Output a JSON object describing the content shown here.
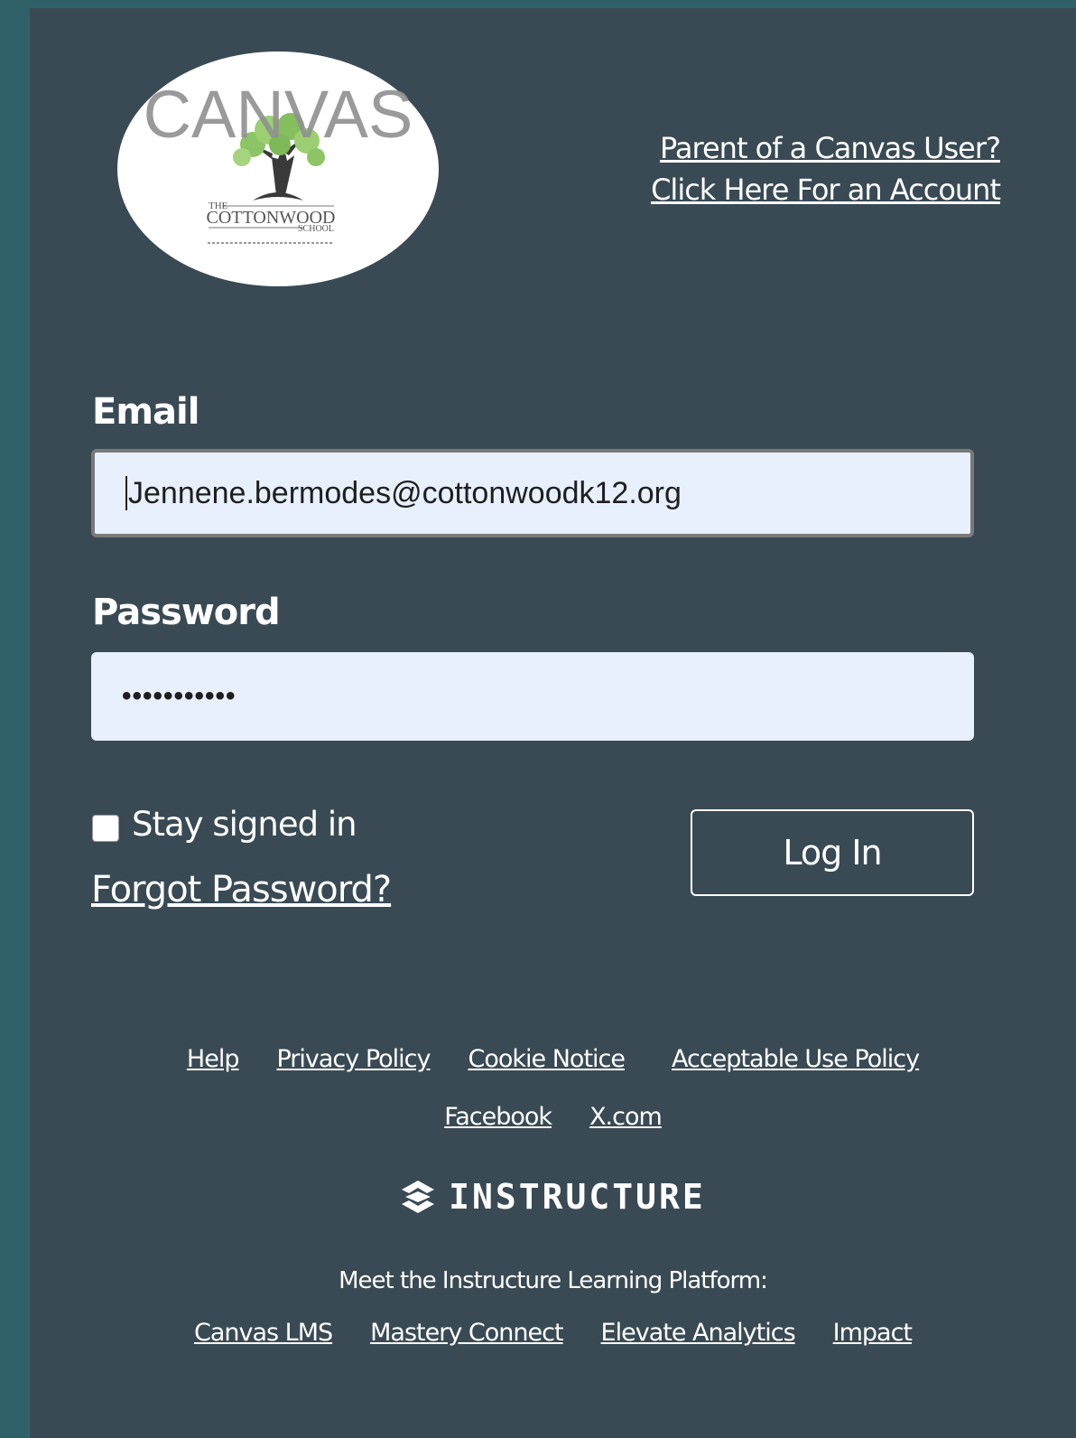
{
  "logo": {
    "title": "CANVAS",
    "school_line1": "THE",
    "school_line2": "COTTONWOOD",
    "school_line3": "SCHOOL"
  },
  "header": {
    "parent_link_line1": "Parent of a Canvas User?",
    "parent_link_line2": "Click Here For an Account"
  },
  "form": {
    "email_label": "Email",
    "email_value": "Jennene.bermodes@cottonwoodk12.org",
    "password_label": "Password",
    "password_value": "•••••••••••",
    "stay_signed_in_label": "Stay signed in",
    "forgot_password_label": "Forgot Password?",
    "login_button_label": "Log In"
  },
  "footer": {
    "links_row1": [
      "Help",
      "Privacy Policy",
      "Cookie Notice",
      "Acceptable Use Policy"
    ],
    "links_row2": [
      "Facebook",
      "X.com"
    ],
    "brand_name": "INSTRUCTURE",
    "tagline": "Meet the Instructure Learning Platform:",
    "platform_links": [
      "Canvas LMS",
      "Mastery Connect",
      "Elevate Analytics",
      "Impact"
    ]
  },
  "colors": {
    "outer_background": "#2f6068",
    "panel_background": "#394a54",
    "input_background": "#e8f0fe",
    "text": "#ffffff"
  }
}
